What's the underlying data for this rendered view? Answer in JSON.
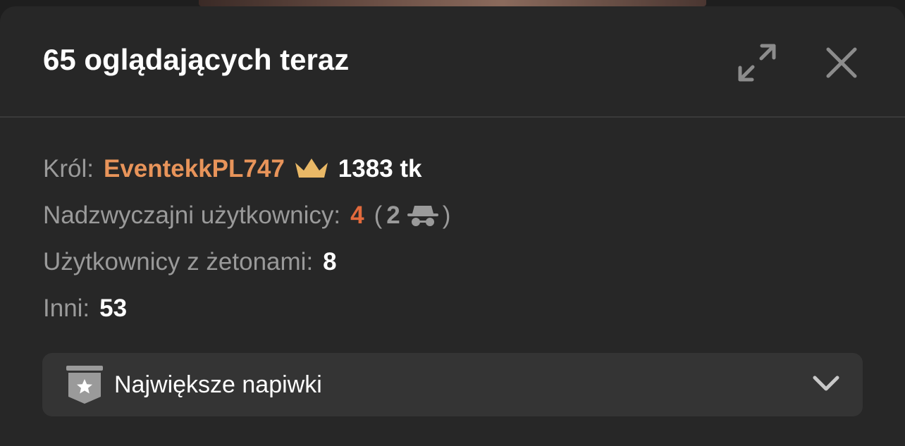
{
  "header": {
    "title": "65 oglądających teraz"
  },
  "icons": {
    "expand": "expand-icon",
    "close": "close-icon",
    "crown": "crown-icon",
    "incognito": "incognito-icon",
    "badge": "star-badge-icon",
    "chevron": "chevron-down-icon"
  },
  "colors": {
    "king_name": "#e8945a",
    "extraordinary_count": "#e26a3c",
    "crown": "#e9b866"
  },
  "stats": {
    "king": {
      "label": "Król:",
      "username": "EventekkPL747",
      "tokens": "1383 tk"
    },
    "extraordinary": {
      "label": "Nadzwyczajni użytkownicy:",
      "count": "4",
      "open_paren": "(",
      "hidden_count": "2",
      "close_paren": ")"
    },
    "token_users": {
      "label": "Użytkownicy z żetonami:",
      "count": "8"
    },
    "others": {
      "label": "Inni:",
      "count": "53"
    }
  },
  "dropdown": {
    "label": "Największe napiwki"
  }
}
